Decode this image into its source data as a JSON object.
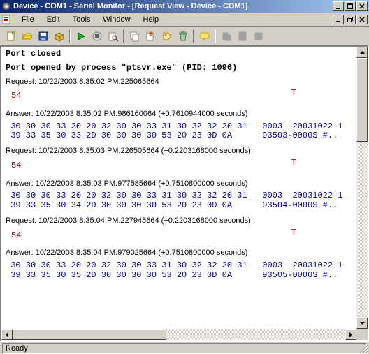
{
  "title": "Device - COM1 - Serial Monitor - [Request View - Device - COM1]",
  "menubar": {
    "file": "File",
    "edit": "Edit",
    "tools": "Tools",
    "window": "Window",
    "help": "Help"
  },
  "content": {
    "port_closed": "Port closed",
    "port_opened": "Port opened by process \"ptsvr.exe\" (PID: 1096)",
    "r1_line": "Request: 10/22/2003 8:35:02 PM.225065664",
    "r1_hex": "54",
    "r1_ascii": "T",
    "a1_line": "Answer: 10/22/2003 8:35:02 PM.986160064 (+0.7610944000 seconds)",
    "a1_hex": " 30 30 30 33 20 20 32 30 30 33 31 30 32 32 20 31   0003  20031022 1\n 39 33 35 30 33 2D 30 30 30 30 53 20 23 0D 0A      93503-0000S #..",
    "r2_line": "Request: 10/22/2003 8:35:03 PM.226505664 (+0.2203168000 seconds)",
    "r2_hex": "54",
    "r2_ascii": "T",
    "a2_line": "Answer: 10/22/2003 8:35:03 PM.977585664 (+0.7510800000 seconds)",
    "a2_hex": " 30 30 30 33 20 20 32 30 30 33 31 30 32 32 20 31   0003  20031022 1\n 39 33 35 30 34 2D 30 30 30 30 53 20 23 0D 0A      93504-0000S #..",
    "r3_line": "Request: 10/22/2003 8:35:04 PM.227945664 (+0.2203168000 seconds)",
    "r3_hex": "54",
    "r3_ascii": "T",
    "a3_line": "Answer: 10/22/2003 8:35:04 PM.979025664 (+0.7510800000 seconds)",
    "a3_hex": " 30 30 30 33 20 20 32 30 30 33 31 30 32 32 20 31   0003  20031022 1\n 39 33 35 30 35 2D 30 30 30 30 53 20 23 0D 0A      93505-0000S #.."
  },
  "status": {
    "text": "Ready"
  }
}
